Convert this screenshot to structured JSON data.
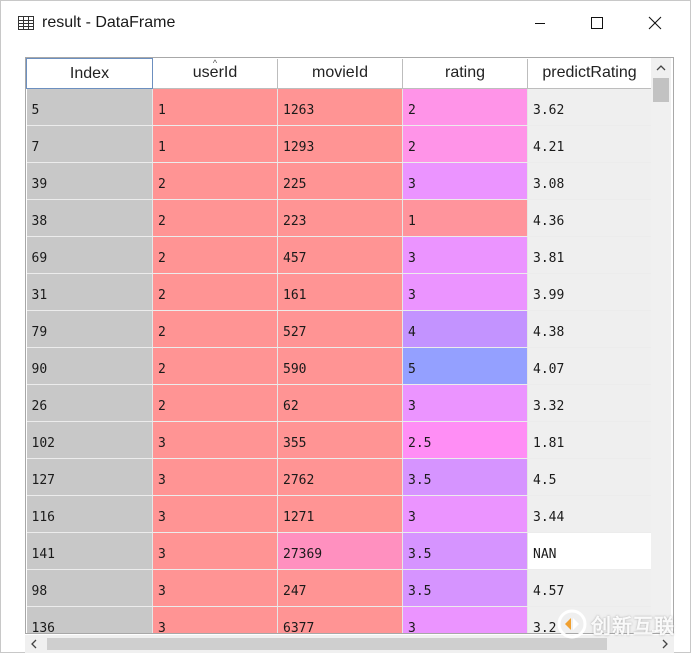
{
  "window": {
    "title": "result - DataFrame"
  },
  "table": {
    "columns": [
      "Index",
      "userId",
      "movieId",
      "rating",
      "predictRating"
    ],
    "rows": [
      {
        "index": "5",
        "userId": "1",
        "movieId": "1263",
        "rating": "2",
        "predictRating": "3.62"
      },
      {
        "index": "7",
        "userId": "1",
        "movieId": "1293",
        "rating": "2",
        "predictRating": "4.21"
      },
      {
        "index": "39",
        "userId": "2",
        "movieId": "225",
        "rating": "3",
        "predictRating": "3.08"
      },
      {
        "index": "38",
        "userId": "2",
        "movieId": "223",
        "rating": "1",
        "predictRating": "4.36"
      },
      {
        "index": "69",
        "userId": "2",
        "movieId": "457",
        "rating": "3",
        "predictRating": "3.81"
      },
      {
        "index": "31",
        "userId": "2",
        "movieId": "161",
        "rating": "3",
        "predictRating": "3.99"
      },
      {
        "index": "79",
        "userId": "2",
        "movieId": "527",
        "rating": "4",
        "predictRating": "4.38"
      },
      {
        "index": "90",
        "userId": "2",
        "movieId": "590",
        "rating": "5",
        "predictRating": "4.07"
      },
      {
        "index": "26",
        "userId": "2",
        "movieId": "62",
        "rating": "3",
        "predictRating": "3.32"
      },
      {
        "index": "102",
        "userId": "3",
        "movieId": "355",
        "rating": "2.5",
        "predictRating": "1.81"
      },
      {
        "index": "127",
        "userId": "3",
        "movieId": "2762",
        "rating": "3.5",
        "predictRating": "4.5"
      },
      {
        "index": "116",
        "userId": "3",
        "movieId": "1271",
        "rating": "3",
        "predictRating": "3.44"
      },
      {
        "index": "141",
        "userId": "3",
        "movieId": "27369",
        "rating": "3.5",
        "predictRating": "NAN"
      },
      {
        "index": "98",
        "userId": "3",
        "movieId": "247",
        "rating": "3.5",
        "predictRating": "4.57"
      },
      {
        "index": "136",
        "userId": "3",
        "movieId": "6377",
        "rating": "3",
        "predictRating": "3.2"
      }
    ],
    "cell_colors": {
      "userId": "#ff9494",
      "movieId": [
        "#ff9494",
        "#ff9494",
        "#ff9494",
        "#ff9494",
        "#ff9494",
        "#ff9494",
        "#ff9494",
        "#ff9494",
        "#ff9494",
        "#ff9494",
        "#ff9494",
        "#ff9494",
        "#ff90bf",
        "#ff9494",
        "#ff9494"
      ],
      "rating": [
        "#ff94e8",
        "#ff94e8",
        "#eb94ff",
        "#ff949c",
        "#eb94ff",
        "#eb94ff",
        "#c393ff",
        "#94a0ff",
        "#eb94ff",
        "#ff8ef5",
        "#d694ff",
        "#eb94ff",
        "#d694ff",
        "#d694ff",
        "#eb94ff"
      ],
      "predictRating": [
        "#efefef",
        "#efefef",
        "#efefef",
        "#efefef",
        "#efefef",
        "#efefef",
        "#efefef",
        "#efefef",
        "#efefef",
        "#efefef",
        "#efefef",
        "#efefef",
        "#ffffff",
        "#efefef",
        "#efefef"
      ],
      "index": "#c8c8c8"
    }
  },
  "icons": {
    "app": "table-icon",
    "minimize": "minimize-icon",
    "maximize": "maximize-icon",
    "close": "close-icon"
  },
  "watermark": {
    "text": "创新互联"
  }
}
